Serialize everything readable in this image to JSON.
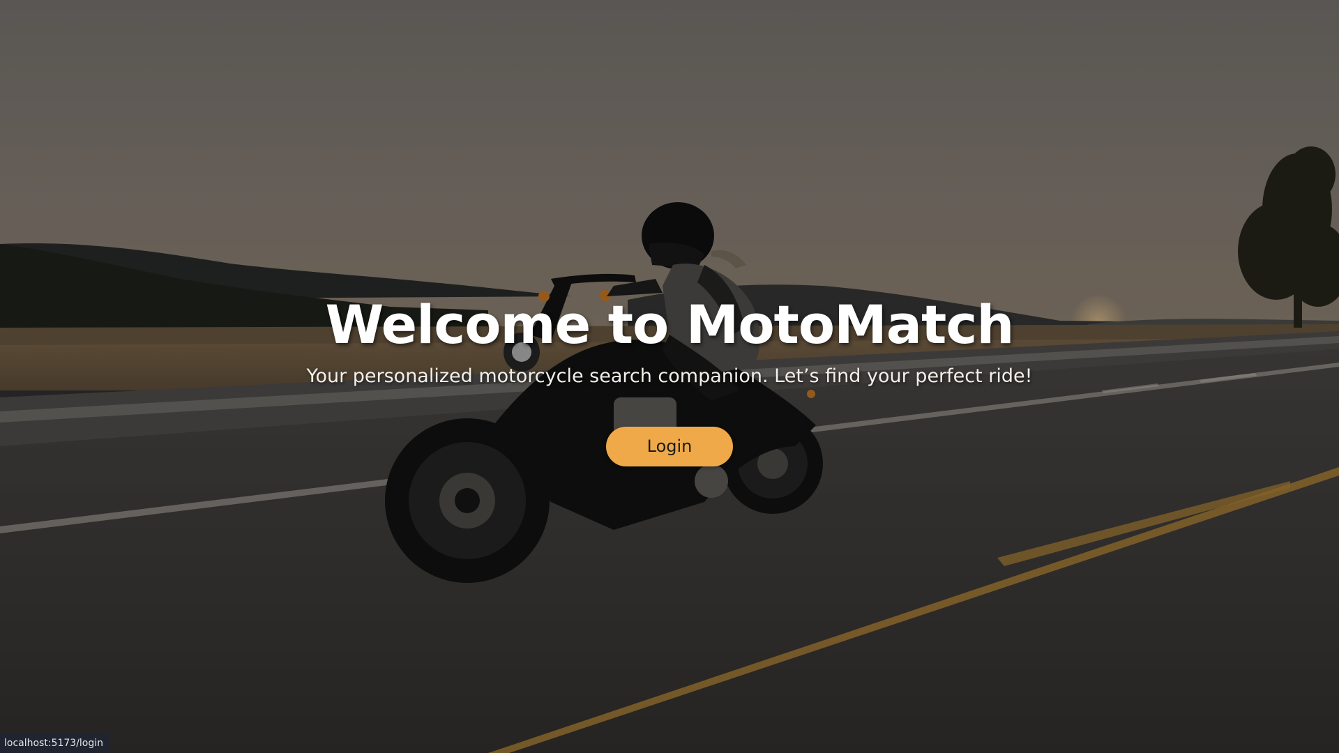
{
  "hero": {
    "title": "Welcome to MotoMatch",
    "subtitle": "Your personalized motorcycle search companion. Let’s find your perfect ride!",
    "login_label": "Login"
  },
  "status_bar": {
    "url": "localhost:5173/login"
  },
  "colors": {
    "accent": "#f0a948",
    "title_text": "#ffffff",
    "status_bg": "#1f2430"
  }
}
